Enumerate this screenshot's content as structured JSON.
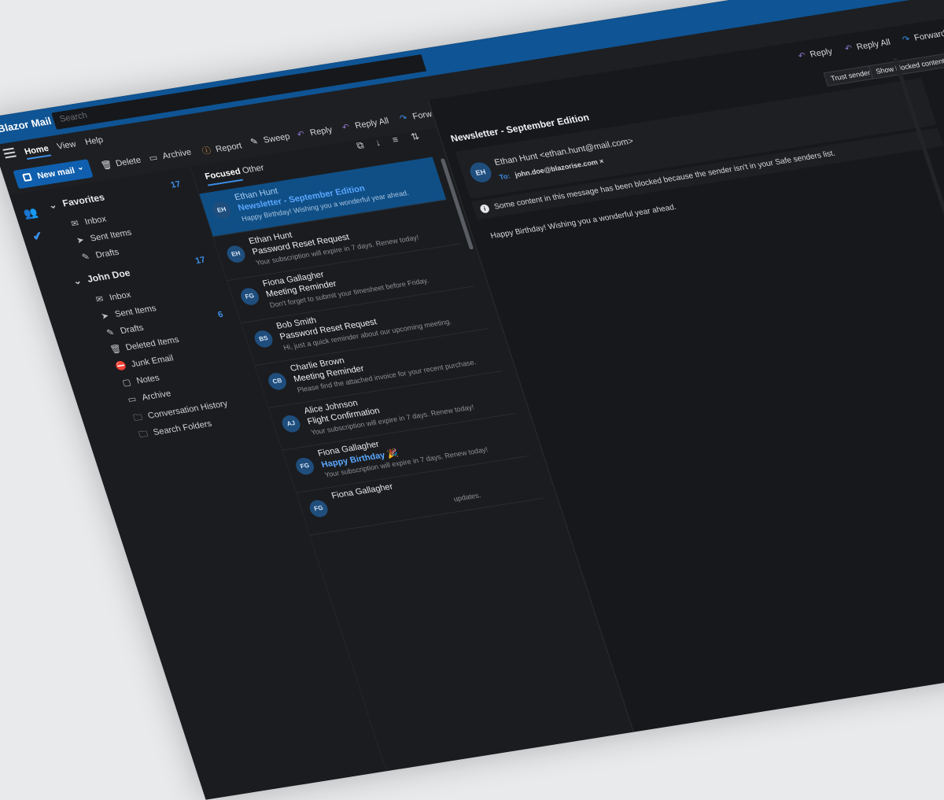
{
  "app": {
    "brand": "Blazor Mail",
    "search_placeholder": "Search"
  },
  "menubar": {
    "items": [
      "Home",
      "View",
      "Help"
    ]
  },
  "toolbar": {
    "new_mail": "New mail",
    "delete": "Delete",
    "archive": "Archive",
    "report": "Report",
    "sweep": "Sweep",
    "reply": "Reply",
    "reply_all": "Reply All",
    "forward": "Forward"
  },
  "sidebar": {
    "favorites": {
      "title": "Favorites",
      "count": "17",
      "folders": [
        "Inbox",
        "Sent Items",
        "Drafts"
      ]
    },
    "account": {
      "title": "John Doe",
      "count": "17",
      "drafts_count": "6",
      "folders": [
        "Inbox",
        "Sent Items",
        "Drafts",
        "Deleted Items",
        "Junk Email",
        "Notes",
        "Archive",
        "Conversation History",
        "Search Folders"
      ]
    }
  },
  "list": {
    "tabs": [
      "Focused",
      "Other"
    ],
    "messages": [
      {
        "initials": "EH",
        "from": "Ethan Hunt",
        "subject": "Newsletter - September Edition",
        "preview": "Happy Birthday! Wishing you a wonderful year ahead."
      },
      {
        "initials": "EH",
        "from": "Ethan Hunt",
        "subject": "Password Reset Request",
        "preview": "Your subscription will expire in 7 days. Renew today!"
      },
      {
        "initials": "FG",
        "from": "Fiona Gallagher",
        "subject": "Meeting Reminder",
        "preview": "Don't forget to submit your timesheet before Friday."
      },
      {
        "initials": "BS",
        "from": "Bob Smith",
        "subject": "Password Reset Request",
        "preview": "Hi, just a quick reminder about our upcoming meeting."
      },
      {
        "initials": "CB",
        "from": "Charlie Brown",
        "subject": "Meeting Reminder",
        "preview": "Please find the attached invoice for your recent purchase."
      },
      {
        "initials": "AJ",
        "from": "Alice Johnson",
        "subject": "Flight Confirmation",
        "preview": "Your subscription will expire in 7 days. Renew today!"
      },
      {
        "initials": "FG",
        "from": "Fiona Gallagher",
        "subject": "Happy Birthday 🎉",
        "preview": "Your subscription will expire in 7 days. Renew today!"
      },
      {
        "initials": "FG",
        "from": "Fiona Gallagher",
        "subject": "",
        "preview": "updates."
      }
    ]
  },
  "reader": {
    "subject": "Newsletter - September Edition",
    "reply": "Reply",
    "reply_all": "Reply All",
    "forward": "Forward",
    "trust_sender": "Trust sender",
    "show_blocked": "Show blocked content",
    "avatar": "EH",
    "sender": "Ethan Hunt <ethan.hunt@mail.com>",
    "to_label": "To:",
    "to_address": "john.doe@blazorise.com ×",
    "notice": "Some content in this message has been blocked because the sender isn't in your Safe senders list.",
    "body": "Happy Birthday! Wishing you a wonderful year ahead."
  }
}
